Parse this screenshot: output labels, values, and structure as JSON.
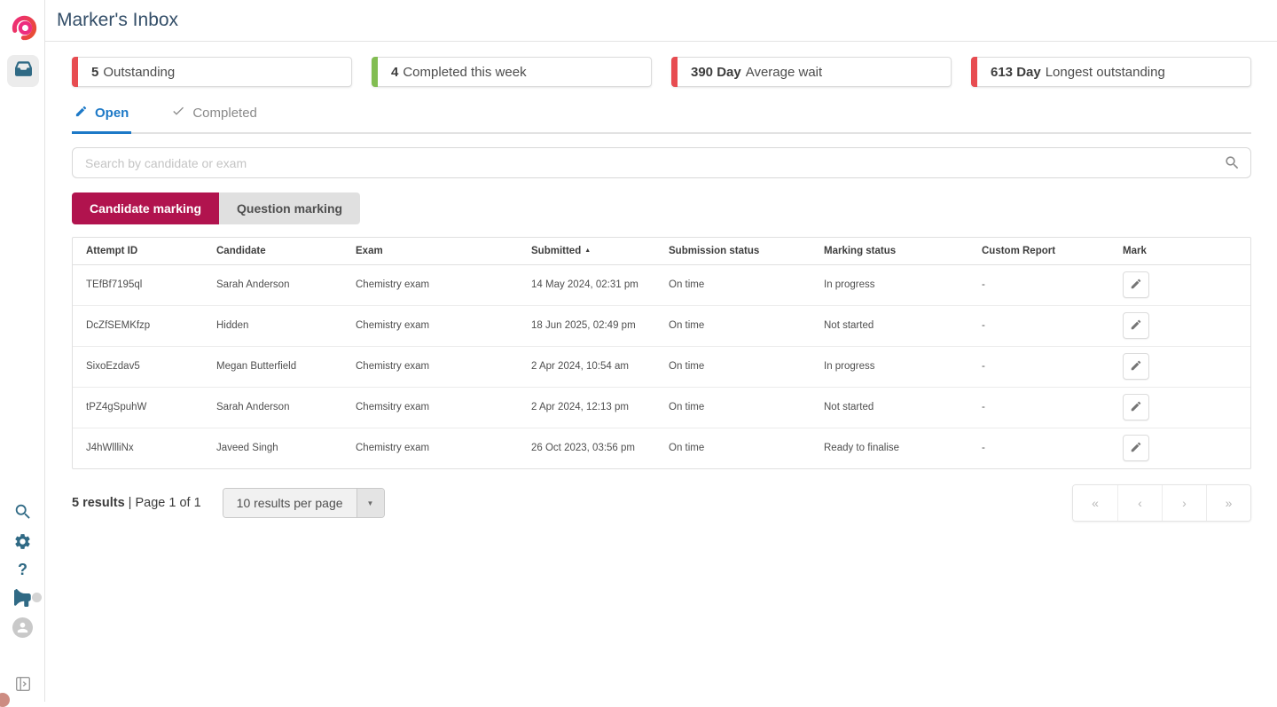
{
  "header": {
    "title": "Marker's Inbox"
  },
  "colors": {
    "accent_red": "#e74c51",
    "accent_green": "#82bd52",
    "tab_active_blue": "#1d79c7",
    "primary_crimson": "#b1134e",
    "icon_teal": "#306a85",
    "title_slate": "#334e68"
  },
  "sidebar": {
    "logo": "cirrus-logo",
    "top_items": [
      {
        "icon": "inbox-icon",
        "active": true
      }
    ],
    "bottom_items": [
      {
        "icon": "search-icon"
      },
      {
        "icon": "gear-icon"
      },
      {
        "icon": "help-icon",
        "glyph": "?"
      },
      {
        "icon": "megaphone-icon",
        "has_badge": true
      },
      {
        "icon": "avatar-icon"
      },
      {
        "icon": "collapse-panel-icon"
      }
    ]
  },
  "stats": [
    {
      "value": "5",
      "label": "Outstanding",
      "accent": "#e74c51"
    },
    {
      "value": "4",
      "label": "Completed this week",
      "accent": "#82bd52"
    },
    {
      "value": "390 Day",
      "label": "Average wait",
      "accent": "#e74c51"
    },
    {
      "value": "613 Day",
      "label": "Longest outstanding",
      "accent": "#e74c51"
    }
  ],
  "tabs": [
    {
      "label": "Open",
      "icon": "pencil-icon",
      "active": true
    },
    {
      "label": "Completed",
      "icon": "check-icon",
      "active": false
    }
  ],
  "search": {
    "placeholder": "Search by candidate or exam",
    "value": ""
  },
  "marking_toggle": [
    {
      "label": "Candidate marking",
      "active": true
    },
    {
      "label": "Question marking",
      "active": false
    }
  ],
  "table": {
    "columns": [
      "Attempt ID",
      "Candidate",
      "Exam",
      "Submitted",
      "Submission status",
      "Marking status",
      "Custom Report",
      "Mark"
    ],
    "sort": {
      "column": "Submitted",
      "direction": "asc"
    },
    "rows": [
      {
        "attempt_id": "TEfBf7195ql",
        "candidate": "Sarah Anderson",
        "exam": "Chemistry exam",
        "submitted": "14 May 2024, 02:31 pm",
        "submission_status": "On time",
        "marking_status": "In progress",
        "custom_report": "-"
      },
      {
        "attempt_id": "DcZfSEMKfzp",
        "candidate": "Hidden",
        "exam": "Chemistry exam",
        "submitted": "18 Jun 2025, 02:49 pm",
        "submission_status": "On time",
        "marking_status": "Not started",
        "custom_report": "-"
      },
      {
        "attempt_id": "SixoEzdav5",
        "candidate": "Megan Butterfield",
        "exam": "Chemistry exam",
        "submitted": "2 Apr 2024, 10:54 am",
        "submission_status": "On time",
        "marking_status": "In progress",
        "custom_report": "-"
      },
      {
        "attempt_id": "tPZ4gSpuhW",
        "candidate": "Sarah Anderson",
        "exam": "Chemsitry exam",
        "submitted": "2 Apr 2024, 12:13 pm",
        "submission_status": "On time",
        "marking_status": "Not started",
        "custom_report": "-"
      },
      {
        "attempt_id": "J4hWllliNx",
        "candidate": "Javeed Singh",
        "exam": "Chemistry exam",
        "submitted": "26 Oct 2023, 03:56 pm",
        "submission_status": "On time",
        "marking_status": "Ready to finalise",
        "custom_report": "-"
      }
    ]
  },
  "footer": {
    "results_count": "5 results",
    "page_info": " | Page 1 of 1",
    "per_page_label": "10 results per page",
    "pagination": {
      "first": "«",
      "prev": "‹",
      "next": "›",
      "last": "»"
    }
  }
}
